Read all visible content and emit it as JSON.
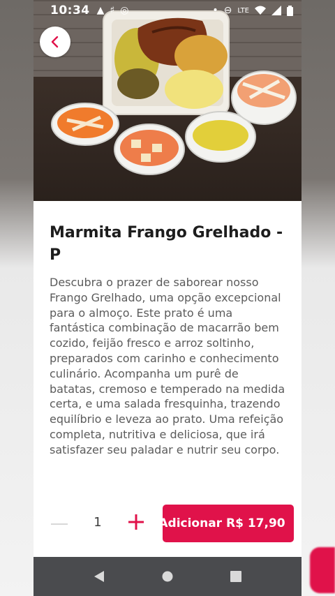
{
  "status_bar": {
    "time": "10:34",
    "icons_left": [
      "warning-icon",
      "tracker-icon",
      "phone-link-icon"
    ],
    "icons_right": [
      "dot-icon",
      "do-not-disturb-icon",
      "volte-icon",
      "wifi-icon",
      "signal-icon",
      "battery-icon"
    ]
  },
  "product": {
    "title": "Marmita Frango Grelhado - P",
    "description": "Descubra o prazer de saborear nosso Frango Grelhado, uma opção excepcional para o almoço. Este prato é uma fantástica combinação de macarrão bem cozido, feijão fresco e arroz soltinho, preparados com carinho e conhecimento culinário. Acompanha um purê de batatas, cremoso e temperado na medida certa, e uma salada fresquinha, trazendo equilíbrio e leveza ao prato. Uma refeição completa, nutritiva e deliciosa, que irá satisfazer seu paladar e nutrir seu corpo."
  },
  "cart": {
    "quantity": "1",
    "add_button_label": "Adicionar R$ 17,90"
  },
  "colors": {
    "accent": "#e0124a",
    "nav_bar": "#4a4b4e"
  },
  "icons": {
    "back": "chevron-left-icon",
    "minus": "minus-icon",
    "plus": "plus-icon",
    "nav_back": "triangle-back-icon",
    "nav_home": "circle-home-icon",
    "nav_recents": "square-recents-icon"
  }
}
